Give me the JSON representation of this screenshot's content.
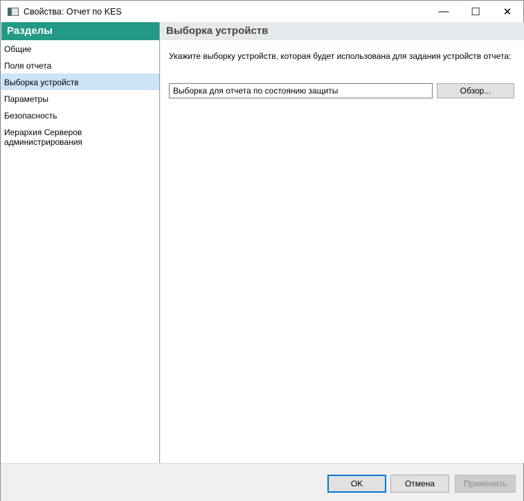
{
  "window": {
    "title": "Свойства: Отчет по KES",
    "minimize": "—",
    "maximize": "☐",
    "close": "✕"
  },
  "sidebar": {
    "header": "Разделы",
    "items": [
      {
        "label": "Общие"
      },
      {
        "label": "Поля отчета"
      },
      {
        "label": "Выборка устройств",
        "selected": true
      },
      {
        "label": "Параметры"
      },
      {
        "label": "Безопасность"
      },
      {
        "label": "Иерархия Серверов администрирования"
      }
    ]
  },
  "main": {
    "header": "Выборка устройств",
    "description": "Укажите выборку устройств, которая будет использована для задания устройств отчета:",
    "selection_value": "Выборка для отчета по состоянию защиты",
    "browse_label": "Обзор..."
  },
  "footer": {
    "ok": "OK",
    "cancel": "Отмена",
    "apply": "Применить"
  }
}
